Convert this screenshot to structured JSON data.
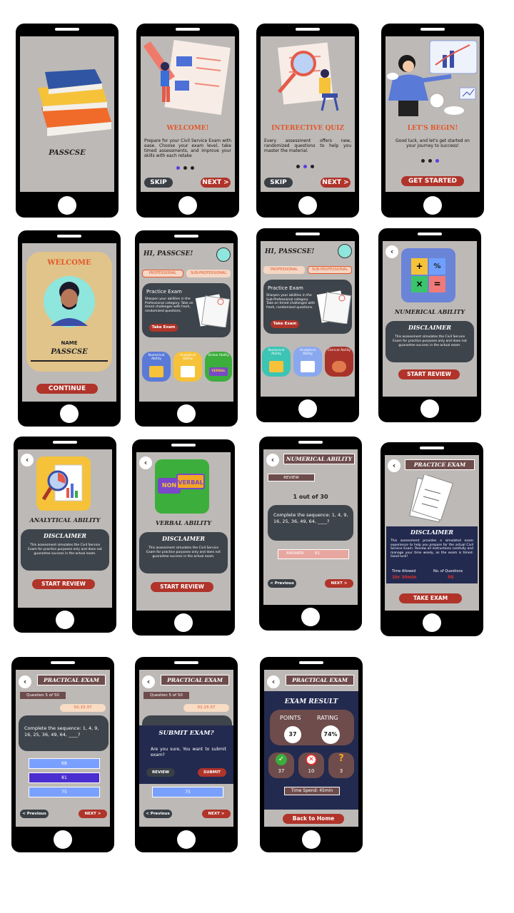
{
  "s1": {
    "title": "PASSCSE"
  },
  "s2": {
    "title": "WELCOME!",
    "body": "Prepare for your Civil Service Exam with ease. Choose your exam level, take timed assessments, and improve your skills with each retake",
    "skip": "SKIP",
    "next": "NEXT >"
  },
  "s3": {
    "title": "INTERECTIVE QUIZ",
    "body": "Every assessment offers new, randomized questions to help you master the material.",
    "skip": "SKIP",
    "next": "NEXT >"
  },
  "s4": {
    "title": "LET'S BEGIN!",
    "body": "Good luck, and let's get started on your journey to success!",
    "cta": "GET STARTED"
  },
  "s5": {
    "title": "WELCOME",
    "name_label": "NAME",
    "name": "PASSCSE",
    "cta": "CONTINUE"
  },
  "home": {
    "greeting": "HI, PASSCSE!",
    "tab_professional": "PROFESSIONAL",
    "tab_sub": "SUB-PROFESSIONAL",
    "card_title": "Practice Exam",
    "card_body_pro": "Sharpen your abilities in the Professional category. Take on timed challenges with fresh, randomized questions.",
    "card_body_sub": "Sharpen your abilities in the Sub-Professional category. Take on timed challenges with fresh, randomized questions.",
    "take_exam": "Take Exam",
    "numerical": "Numerical Ability",
    "analytical": "Analytical Ability",
    "verbal": "Verbal Ability",
    "clerical": "Clerical Ability",
    "verbal_badge": "VERBAL"
  },
  "disclaimer": {
    "heading": "DISCLAIMER",
    "body": "This assessment simulates the Civil Service Exam for practice purposes only and does not guarantee success in the actual exam.",
    "start": "START REVIEW"
  },
  "numerical": {
    "title": "NUMERICAL ABILITY"
  },
  "analytical": {
    "title": "ANALYTICAL ABILITY"
  },
  "verbal": {
    "title": "VERBAL ABILITY",
    "badge_non": "NON",
    "badge_verbal": "VERBAL"
  },
  "review": {
    "header": "NUMERICAL ABILITY",
    "tag": "REVIEW",
    "counter": "1 out of 30",
    "question": "Complete the sequence: 1, 4, 9, 16, 25, 36, 49, 64, ____?",
    "answer_label": "ANSWER:",
    "answer": "81",
    "prev": "< Previous",
    "next": "NEXT >"
  },
  "practice": {
    "header": "PRACTICE EXAM",
    "heading": "DISCLAIMER",
    "body": "This assessment provides a simulated exam experience to help you prepare for the actual Civil Service Exam. Review all instructions carefully and manage your time wisely, as the exam is timed. Good luck!",
    "time_label": "Time Allowed",
    "time_value": "1hr 30min",
    "q_label": "No. of Questions",
    "q_value": "50",
    "cta": "TAKE EXAM"
  },
  "exam": {
    "header": "PRACTICAL EXAM",
    "qnum": "Question 5 of 50",
    "timer": "01:15:37",
    "question": "Complete the sequence: 1, 4, 9, 16, 25, 36, 49, 64, ____?",
    "options": [
      "68",
      "81",
      "75"
    ],
    "prev": "< Previous",
    "next": "NEXT >"
  },
  "submit": {
    "heading": "SUBMIT EXAM?",
    "body": "Are you sure, You want to submit exam?",
    "review": "REVIEW",
    "submit": "SUBMIT"
  },
  "result": {
    "header": "PRACTICAL EXAM",
    "title": "EXAM RESULT",
    "points_label": "POINTS",
    "rating_label": "RATING",
    "points": "37",
    "rating": "74%",
    "correct": "37",
    "wrong": "10",
    "skipped": "3",
    "time_spent": "Time Spend: 45min",
    "home": "Back to Home"
  },
  "colors": {
    "bg": "#bdb9b6",
    "accent": "#b0342a",
    "dark": "#3e444b",
    "navy": "#232a4f",
    "option": "#7aa0ff",
    "option_selected": "#4b2ed0"
  }
}
